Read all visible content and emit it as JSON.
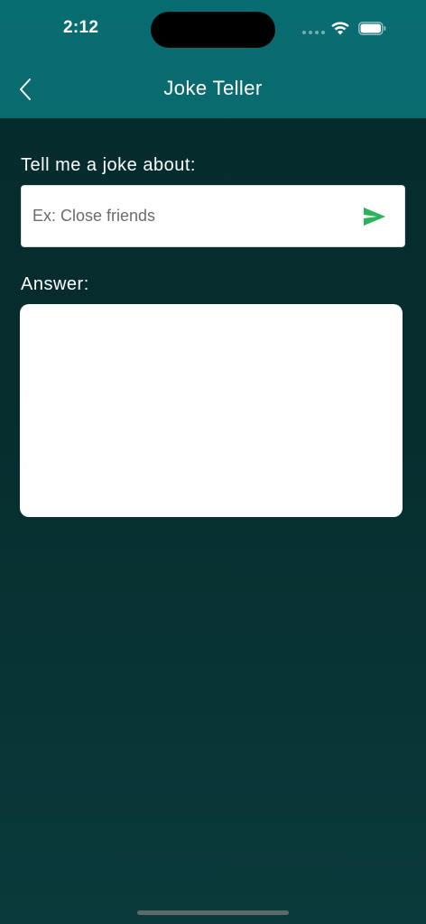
{
  "status_bar": {
    "time": "2:12"
  },
  "nav": {
    "title": "Joke Teller",
    "back_icon": "chevron-left-icon"
  },
  "form": {
    "prompt_label": "Tell me a joke about:",
    "input_placeholder": "Ex: Close friends",
    "input_value": "",
    "send_icon": "send-icon",
    "answer_label": "Answer:",
    "answer_text": ""
  },
  "colors": {
    "header": "#0a6b6f",
    "background": "#062c2d",
    "send_accent": "#2bb35a"
  }
}
